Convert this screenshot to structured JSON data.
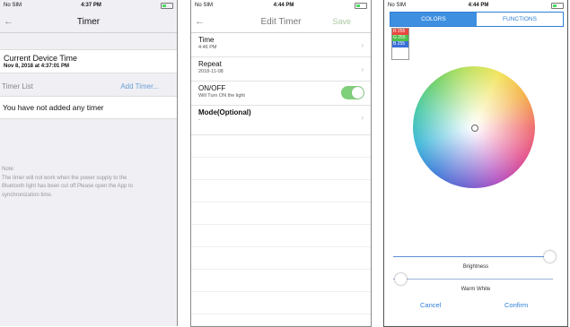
{
  "screen1": {
    "status": {
      "carrier": "No SIM",
      "time": "4:37 PM"
    },
    "title": "Timer",
    "device": {
      "label": "Current Device Time",
      "value": "Nov 8, 2018 at 4:37:01 PM"
    },
    "timer_list_label": "Timer List",
    "add_timer_label": "Add Timer...",
    "empty_message": "You have not added any timer",
    "note": [
      "Note:",
      "The timer will not work when the power supply to the",
      "Bluetooth light has been cut off.Please open the App to",
      "synchronization time."
    ]
  },
  "screen2": {
    "status": {
      "carrier": "No SIM",
      "time": "4:44 PM"
    },
    "title": "Edit Timer",
    "save_label": "Save",
    "rows": [
      {
        "label": "Time",
        "value": "4:46 PM"
      },
      {
        "label": "Repeat",
        "value": "2018-11-08"
      },
      {
        "label": "ON/OFF",
        "value": "Will Turn ON the light"
      },
      {
        "label": "Mode(Optional)",
        "value": "-"
      }
    ],
    "toggle_on": true
  },
  "screen3": {
    "status": {
      "carrier": "No SIM",
      "time": "4:44 PM"
    },
    "tabs": {
      "colors": "COLORS",
      "functions": "FUNCTIONS"
    },
    "rgb": {
      "r": "R 255",
      "g": "G 255",
      "b": "B 255"
    },
    "brightness_label": "Brightness",
    "warm_white_label": "Warm White",
    "brightness_level": 1.0,
    "warm_white_level": 0.0,
    "cancel_label": "Cancel",
    "confirm_label": "Confirm",
    "colors": {
      "accent": "#3f8fe0",
      "r": "#e8483e",
      "g": "#4cc04a",
      "b": "#3a6fd6"
    }
  }
}
